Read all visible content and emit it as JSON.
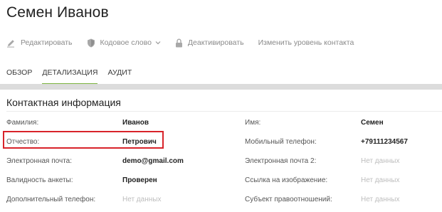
{
  "header": {
    "title": "Семен Иванов"
  },
  "toolbar": {
    "edit_label": "Редактировать",
    "codeword_label": "Кодовое слово",
    "deactivate_label": "Деактивировать",
    "change_level_label": "Изменить уровень контакта"
  },
  "tabs": [
    {
      "label": "ОБЗОР",
      "active": false
    },
    {
      "label": "ДЕТАЛИЗАЦИЯ",
      "active": true
    },
    {
      "label": "АУДИТ",
      "active": false
    }
  ],
  "section": {
    "title": "Контактная информация"
  },
  "fields": {
    "left": [
      {
        "label": "Фамилия:",
        "value": "Иванов",
        "empty": false
      },
      {
        "label": "Отчество:",
        "value": "Петрович",
        "empty": false
      },
      {
        "label": "Электронная почта:",
        "value": "demo@gmail.com",
        "empty": false
      },
      {
        "label": "Валидность анкеты:",
        "value": "Проверен",
        "empty": false
      },
      {
        "label": "Дополнительный телефон:",
        "value": "Нет данных",
        "empty": true
      }
    ],
    "right": [
      {
        "label": "Имя:",
        "value": "Семен",
        "empty": false
      },
      {
        "label": "Мобильный телефон:",
        "value": "+79111234567",
        "empty": false
      },
      {
        "label": "Электронная почта 2:",
        "value": "Нет данных",
        "empty": true
      },
      {
        "label": "Ссылка на изображение:",
        "value": "Нет данных",
        "empty": true
      },
      {
        "label": "Субъект правоотношений:",
        "value": "Нет данных",
        "empty": true
      }
    ]
  },
  "colors": {
    "accent": "#7bb33e",
    "highlight": "#d8232a"
  },
  "icons": {
    "edit": "pencil-icon",
    "codeword": "shield-icon",
    "deactivate": "lock-icon",
    "dropdown": "chevron-down-icon"
  }
}
